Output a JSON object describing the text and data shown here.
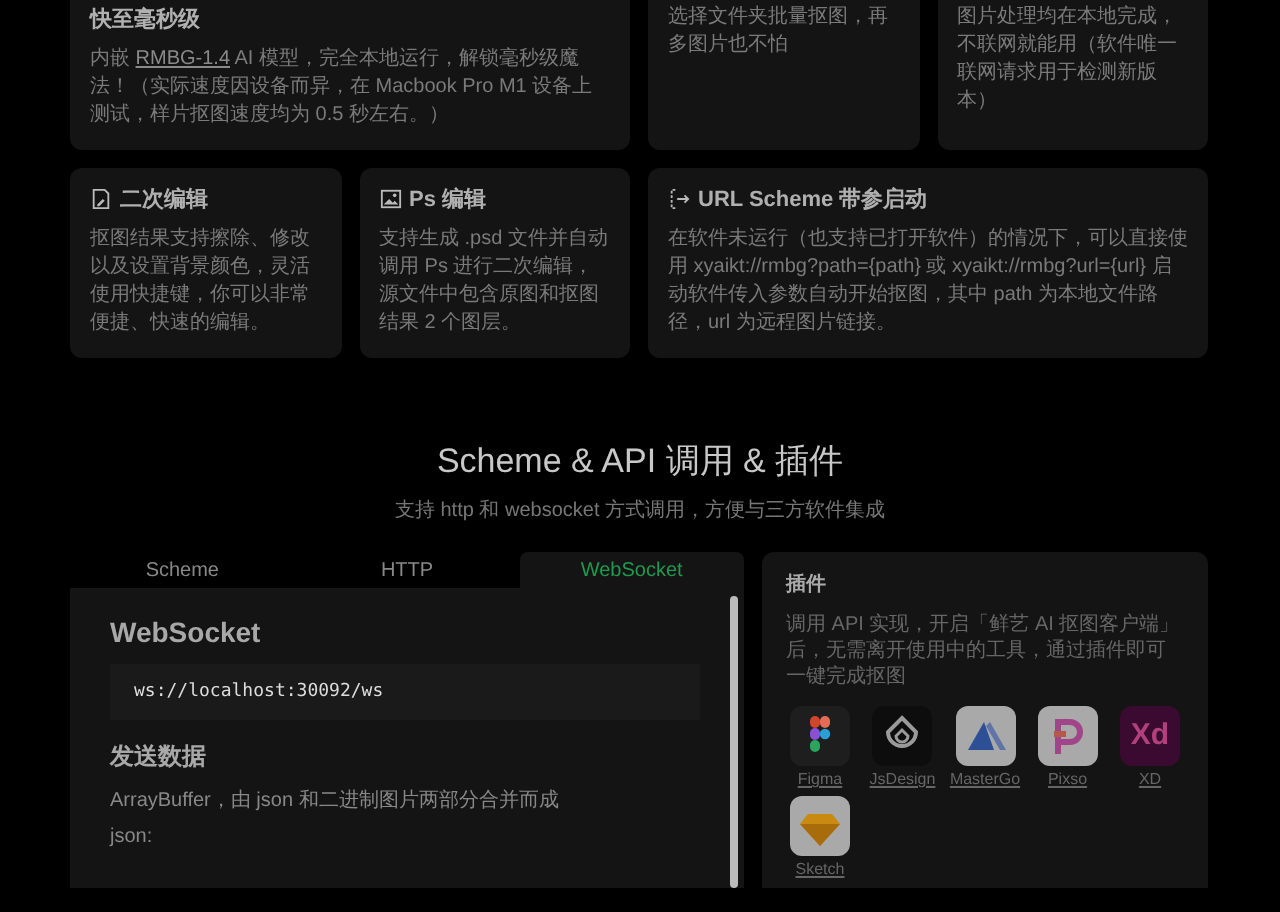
{
  "feature_cards": [
    {
      "kind": "speed",
      "title": "快至毫秒级",
      "text_before": "内嵌 ",
      "link": "RMBG-1.4",
      "text_after": " AI 模型，完全本地运行，解锁毫秒级魔法！（实际速度因设备而异，在 Macbook Pro M1 设备上测试，样片抠图速度均为 0.5 秒左右。）"
    },
    {
      "text": "选择文件夹批量抠图，再多图片也不怕"
    },
    {
      "text": "图片处理均在本地完成，不联网就能用（软件唯一联网请求用于检测新版本）"
    },
    {
      "kind": "edit",
      "title": "二次编辑",
      "text": "抠图结果支持擦除、修改以及设置背景颜色，灵活使用快捷键，你可以非常便捷、快速的编辑。"
    },
    {
      "kind": "ps",
      "title": "Ps 编辑",
      "text": "支持生成 .psd 文件并自动调用 Ps 进行二次编辑，源文件中包含原图和抠图结果 2 个图层。"
    },
    {
      "kind": "scheme",
      "title": "URL Scheme 带参启动",
      "text": "在软件未运行（也支持已打开软件）的情况下，可以直接使用 xyaikt://rmbg?path={path} 或 xyaikt://rmbg?url={url} 启动软件传入参数自动开始抠图，其中 path 为本地文件路径，url 为远程图片链接。"
    }
  ],
  "section": {
    "title": "Scheme & API 调用 & 插件",
    "subtitle": "支持 http 和 websocket 方式调用，方便与三方软件集成"
  },
  "tabs": [
    {
      "label": "Scheme",
      "selected": false
    },
    {
      "label": "HTTP",
      "selected": false
    },
    {
      "label": "WebSocket",
      "selected": true
    }
  ],
  "doc": {
    "title": "WebSocket",
    "code": "ws://localhost:30092/ws",
    "heading": "发送数据",
    "paragraph": "ArrayBuffer，由 json 和二进制图片两部分合并而成",
    "label": "json:"
  },
  "plugins": {
    "title": "插件",
    "description": "调用 API 实现，开启「鲜艺 AI 抠图客户端」后，无需离开使用中的工具，通过插件即可一键完成抠图",
    "items": [
      {
        "kind": "figma",
        "name": "Figma"
      },
      {
        "kind": "jsdesign",
        "name": "JsDesign"
      },
      {
        "kind": "mastergo",
        "name": "MasterGo"
      },
      {
        "kind": "pixso",
        "name": "Pixso"
      },
      {
        "kind": "xd",
        "name": "XD",
        "logo_text": "Xd"
      },
      {
        "kind": "sketch",
        "name": "Sketch"
      }
    ]
  }
}
